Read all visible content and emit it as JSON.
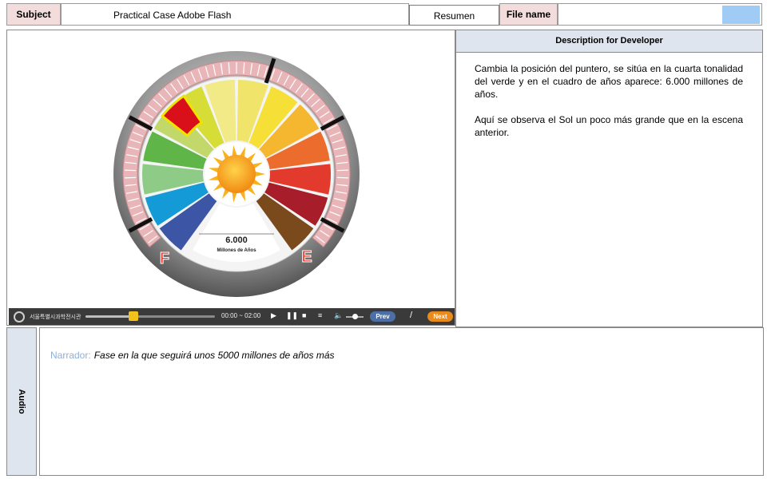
{
  "header": {
    "subject_label": "Subject",
    "subject_value": "Practical Case Adobe Flash",
    "resumen": "Resumen",
    "file_label": "File name",
    "file_value": ""
  },
  "stage": {
    "dial": {
      "value": "6.000",
      "unit": "Millones de Años",
      "label_left": "F",
      "label_right": "E"
    },
    "player": {
      "org_name": "서울특별시과학전시관",
      "time": "00:00 ~ 02:00",
      "play_icon": "play-icon",
      "pause_icon": "pause-icon",
      "stop_icon": "stop-icon",
      "menu_icon": "menu-icon",
      "volume_icon": "speaker-icon",
      "prev_label": "Prev",
      "next_label": "Next",
      "slash": "/"
    }
  },
  "description": {
    "title": "Description for Developer",
    "paragraphs": [
      "Cambia la posición del puntero, se sitúa en la cuarta tonalidad del verde y en el cuadro de años aparece: 6.000 millones de años.",
      "Aquí se observa el Sol un poco más grande que en la escena anterior."
    ],
    "accent_color": "#d42020"
  },
  "audio": {
    "label": "Audio",
    "narrator_label": "Narrador:",
    "narrator_text": "Fase en la que seguirá unos 5000 millones de años más"
  },
  "colors": {
    "header_label_bg": "#f2dcdc",
    "panel_title_bg": "#dfe5ef",
    "swatch": "#9fcbf5",
    "prev_button": "#4d6fa8",
    "next_button": "#e98a1b"
  }
}
